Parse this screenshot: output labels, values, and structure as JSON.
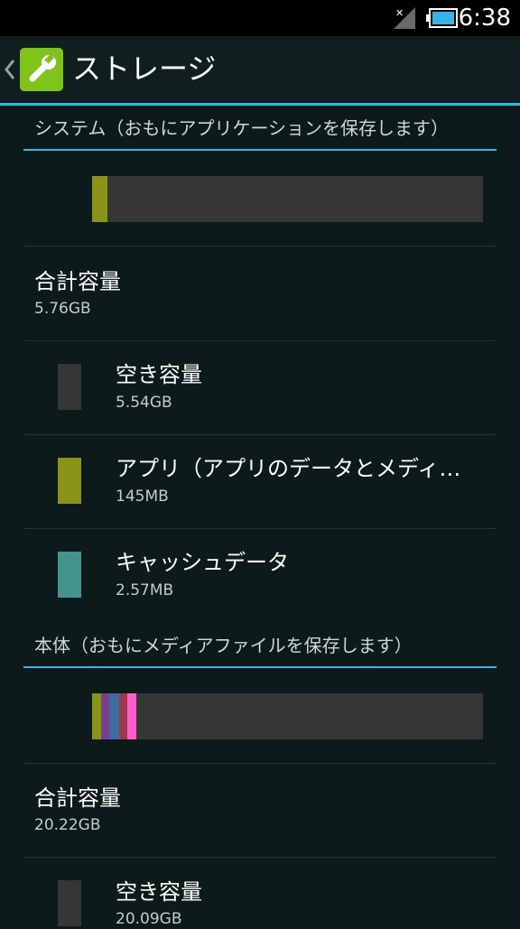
{
  "status_bar": {
    "time": "6:38",
    "icons": [
      "signal-no-service-icon",
      "battery-icon"
    ]
  },
  "action_bar": {
    "title": "ストレージ",
    "icon": "wrench-icon",
    "up_icon": "chevron-left-icon"
  },
  "colors": {
    "accent": "#33b5e5",
    "free": "#363636",
    "apps": "#8a9419",
    "cache": "#45938f",
    "pink": "#ff5ccf"
  },
  "system_section": {
    "header": "システム（おもにアプリケーションを保存します）",
    "usage_bar": [
      {
        "name": "apps",
        "fraction": 0.04,
        "color": "#8a9419"
      },
      {
        "name": "free",
        "fraction": 0.96,
        "color": "#363636"
      }
    ],
    "total": {
      "label": "合計容量",
      "value": "5.76GB"
    },
    "items": [
      {
        "label": "空き容量",
        "value": "5.54GB",
        "color": "#363636"
      },
      {
        "label": "アプリ（アプリのデータとメディ…",
        "value": "145MB",
        "color": "#8a9419"
      },
      {
        "label": "キャッシュデータ",
        "value": "2.57MB",
        "color": "#45938f"
      }
    ]
  },
  "internal_section": {
    "header": "本体（おもにメディアファイルを保存します）",
    "usage_bar": [
      {
        "name": "apps",
        "fraction": 0.023,
        "color": "#8a9419"
      },
      {
        "name": "segment-2",
        "fraction": 0.02,
        "color": "#7a3f8f"
      },
      {
        "name": "segment-3",
        "fraction": 0.025,
        "color": "#3a6fa0"
      },
      {
        "name": "segment-4",
        "fraction": 0.02,
        "color": "#9a3a4a"
      },
      {
        "name": "segment-5",
        "fraction": 0.022,
        "color": "#ff5ccf"
      },
      {
        "name": "free",
        "fraction": 0.89,
        "color": "#363636"
      }
    ],
    "total": {
      "label": "合計容量",
      "value": "20.22GB"
    },
    "items": [
      {
        "label": "空き容量",
        "value": "20.09GB",
        "color": "#363636"
      }
    ]
  }
}
